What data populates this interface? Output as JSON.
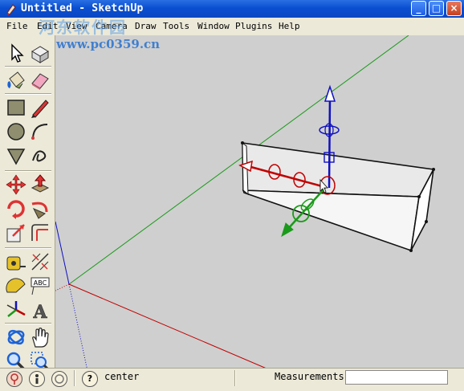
{
  "window": {
    "title": "Untitled - SketchUp",
    "minimize_glyph": "_",
    "maximize_glyph": "□",
    "close_glyph": "×"
  },
  "menu": {
    "items": [
      "File",
      "Edit",
      "View",
      "Camera",
      "Draw",
      "Tools",
      "Window",
      "Plugins",
      "Help"
    ]
  },
  "watermark": {
    "cn": "河东软件园",
    "url": "www.pc0359.cn"
  },
  "toolbar": {
    "tools": [
      "select-tool",
      "make-component-tool",
      "paint-bucket-tool",
      "eraser-tool",
      "rectangle-tool",
      "line-tool",
      "circle-tool",
      "arc-tool",
      "polygon-tool",
      "freehand-tool",
      "move-tool",
      "push-pull-tool",
      "rotate-tool",
      "follow-me-tool",
      "scale-tool",
      "offset-tool",
      "tape-measure-tool",
      "dimension-tool",
      "protractor-tool",
      "text-tool",
      "axes-tool",
      "3d-text-tool",
      "orbit-tool",
      "pan-tool",
      "zoom-tool",
      "zoom-window-tool"
    ]
  },
  "status": {
    "help_glyph": "?",
    "message": "center",
    "measurements_label": "Measurements",
    "measurements_value": ""
  },
  "colors": {
    "x_axis": "#c00000",
    "y_axis": "#1a9a1a",
    "z_axis": "#1010c0",
    "viewport_bg": "#cfcfcf",
    "titlebar": "#0a4fd1"
  }
}
